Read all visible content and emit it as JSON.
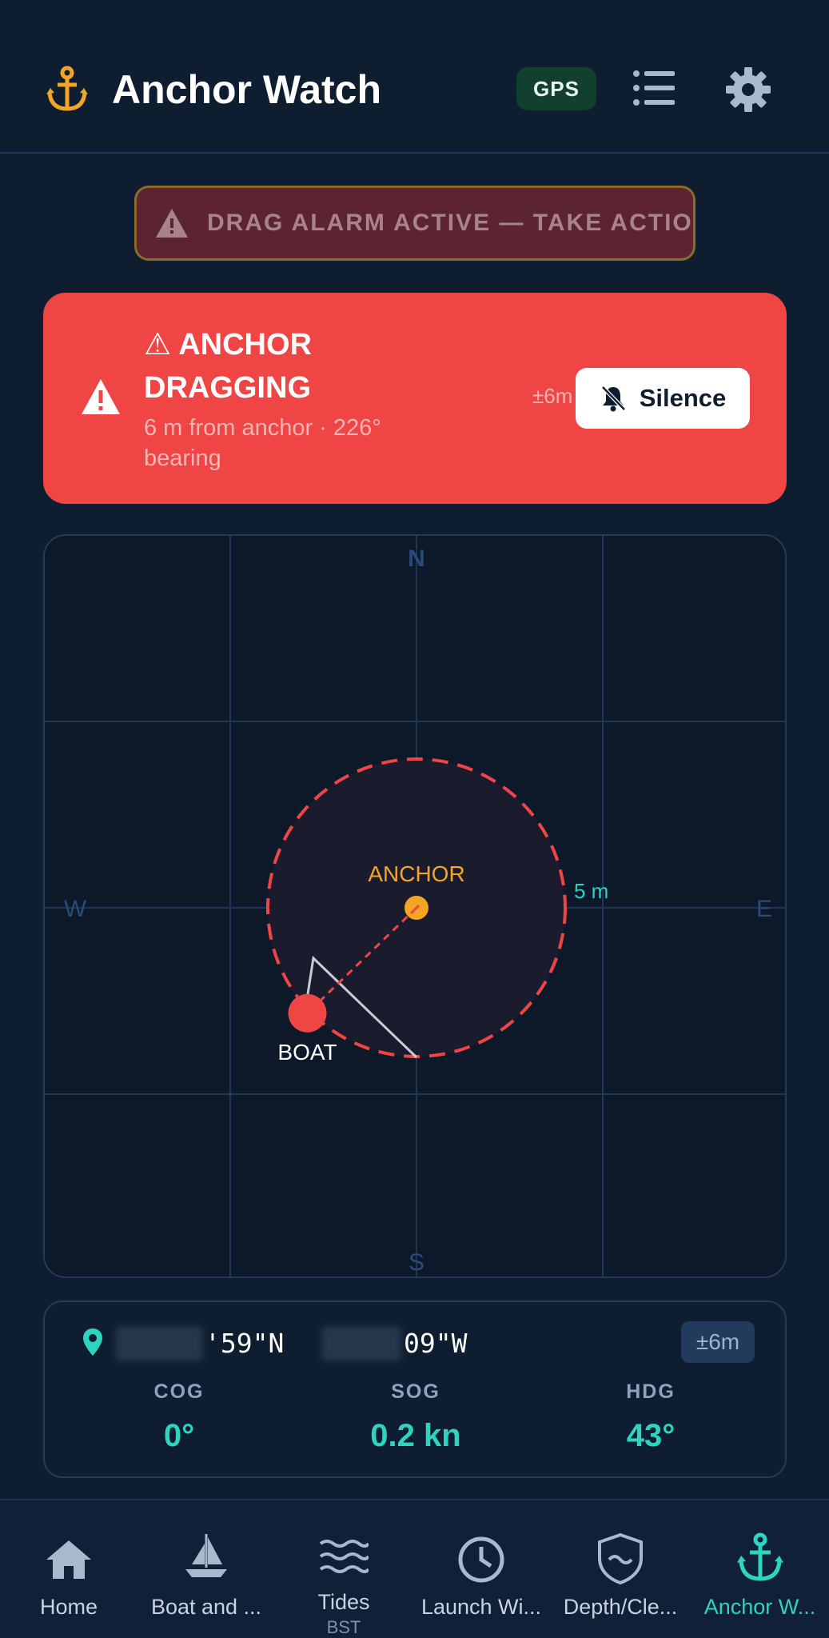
{
  "header": {
    "title": "Anchor Watch",
    "gps_badge": "GPS"
  },
  "drag_banner": {
    "text": "DRAG ALARM ACTIVE — TAKE ACTION"
  },
  "alert": {
    "title": "⚠ ANCHOR DRAGGING",
    "subtitle": "6 m from anchor · 226° bearing",
    "accuracy": "±6m",
    "silence_label": "Silence"
  },
  "radar": {
    "north": "N",
    "south": "S",
    "east": "E",
    "west": "W",
    "anchor_label": "ANCHOR",
    "boat_label": "BOAT",
    "radius_label": "5 m",
    "alarm_radius_m": 5,
    "boat_distance_m": 6,
    "boat_bearing_deg": 226,
    "colors": {
      "alarm": "#ef4545",
      "anchor": "#f5a524",
      "radius_text": "#2dd4bf"
    }
  },
  "position": {
    "lat_visible": "'59\"N",
    "lon_visible": "09\"W",
    "accuracy": "±6m",
    "stats": [
      {
        "label": "COG",
        "value": "0°"
      },
      {
        "label": "SOG",
        "value": "0.2 kn"
      },
      {
        "label": "HDG",
        "value": "43°"
      }
    ]
  },
  "nav": {
    "items": [
      {
        "label": "Home",
        "icon": "home-icon"
      },
      {
        "label": "Boat and ...",
        "icon": "sailboat-icon"
      },
      {
        "label": "Tides",
        "sub": "BST",
        "icon": "waves-icon"
      },
      {
        "label": "Launch Wi...",
        "icon": "clock-icon"
      },
      {
        "label": "Depth/Cle...",
        "icon": "shield-wave-icon"
      },
      {
        "label": "Anchor W...",
        "icon": "anchor-icon",
        "active": true
      }
    ]
  },
  "theme": {
    "background": "#0f1d30",
    "accent": "#2dd4bf",
    "alert": "#ef4545",
    "anchor_orange": "#f5a524"
  }
}
